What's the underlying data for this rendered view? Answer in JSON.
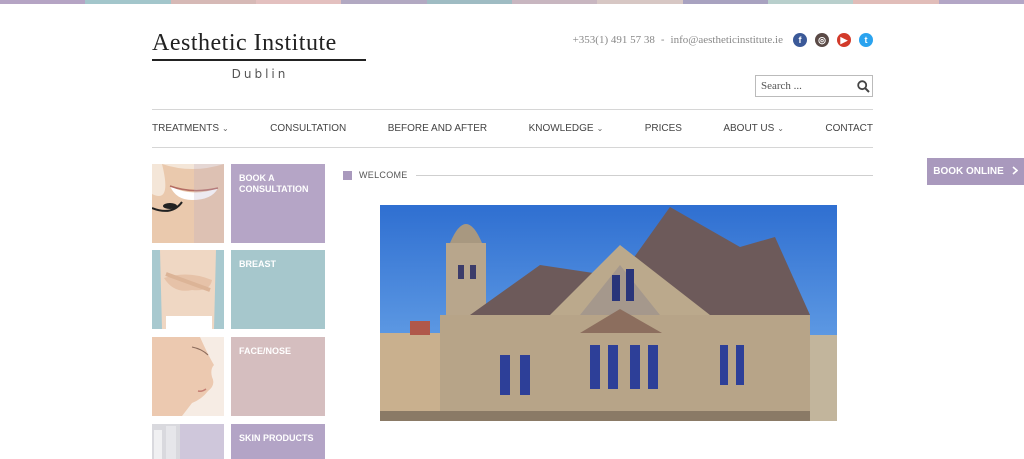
{
  "top_stripe_colors": [
    "#b5a4c4",
    "#a3c6cb",
    "#d6b9b6",
    "#e3c0bf",
    "#b2a9c2",
    "#9fbcc3",
    "#c8b6c0",
    "#d7c7c4",
    "#a8a2c0",
    "#b8cfcc",
    "#e1bdb9",
    "#b3a6c6"
  ],
  "logo": {
    "title": "Aesthetic Institute",
    "subtitle": "Dublin"
  },
  "contact": {
    "phone": "+353(1) 491 57 38",
    "separator": "-",
    "email": "info@aestheticinstitute.ie"
  },
  "social": [
    {
      "icon": "facebook-icon",
      "glyph": "f",
      "color": "#3b5998"
    },
    {
      "icon": "instagram-icon",
      "glyph": "◎",
      "color": "#5a4a46"
    },
    {
      "icon": "youtube-icon",
      "glyph": "▶",
      "color": "#d23a2a"
    },
    {
      "icon": "twitter-icon",
      "glyph": "t",
      "color": "#2aa3ef"
    }
  ],
  "search": {
    "placeholder": "Search ...",
    "icon": "search-icon"
  },
  "nav": {
    "items": [
      {
        "label": "TREATMENTS",
        "has_dropdown": true
      },
      {
        "label": "CONSULTATION",
        "has_dropdown": false
      },
      {
        "label": "BEFORE AND AFTER",
        "has_dropdown": false
      },
      {
        "label": "KNOWLEDGE",
        "has_dropdown": true
      },
      {
        "label": "PRICES",
        "has_dropdown": false
      },
      {
        "label": "ABOUT US",
        "has_dropdown": true
      },
      {
        "label": "CONTACT",
        "has_dropdown": false
      }
    ],
    "chevron": "⌄"
  },
  "book_online": {
    "label": "BOOK ONLINE",
    "icon": "chevron-right-icon",
    "color": "#a999bd"
  },
  "tiles": [
    {
      "label": "BOOK A CONSULTATION",
      "color": "#b5a5c6",
      "image": "smiling-woman-headset-photo"
    },
    {
      "label": "BREAST",
      "color": "#a6c7cc",
      "image": "woman-torso-photo"
    },
    {
      "label": "FACE/NOSE",
      "color": "#d5bebf",
      "image": "woman-face-profile-photo"
    },
    {
      "label": "SKIN PRODUCTS",
      "color": "#b3a4c6",
      "image": "skin-products-photo"
    }
  ],
  "welcome": {
    "label": "WELCOME",
    "accent": "#a999bd"
  },
  "hero": {
    "image": "stone-building-photo"
  }
}
